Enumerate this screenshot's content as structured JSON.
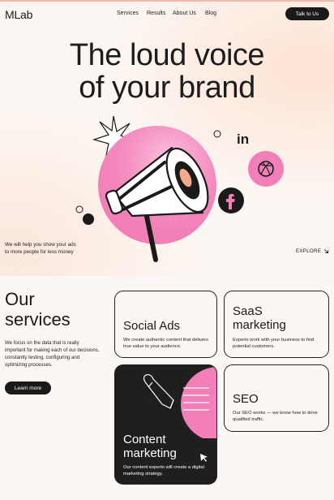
{
  "brand": {
    "logo": "MLab"
  },
  "nav": {
    "links": [
      "Services",
      "Results",
      "About Us",
      "Blog"
    ],
    "cta": "Talk to Us"
  },
  "hero": {
    "headline_line1": "The loud voice",
    "headline_line2": "of your brand",
    "tagline_line1": "We will help you show your ads",
    "tagline_line2": "to more people for less money",
    "explore": "EXPLORE",
    "explore_icon": "arrow-down-right-icon",
    "social_icons": [
      "linkedin-icon",
      "dribbble-icon",
      "facebook-icon"
    ]
  },
  "services": {
    "title_line1": "Our",
    "title_line2": "services",
    "description": "We focus on the data that is really important for making each of our decisions, constantly testing, configuring and optimizing processes.",
    "button": "Learn more",
    "cards": [
      {
        "title_line1": "Social Ads",
        "title_line2": "",
        "text": "We create authentic content that delivers true value to your audience."
      },
      {
        "title_line1": "SaaS",
        "title_line2": "marketing",
        "text": "Experts work with your business to find potential customers."
      },
      {
        "title_line1": "Content",
        "title_line2": "marketing",
        "text": "Our content experts will create a digital marketing strategy."
      },
      {
        "title_line1": "SEO",
        "title_line2": "",
        "text": "Our SEO works — we know how to drive qualified traffic."
      }
    ]
  },
  "colors": {
    "accent_pink": "#f27fb8",
    "dark": "#1f1f1f",
    "background": "#fbf7f4"
  }
}
